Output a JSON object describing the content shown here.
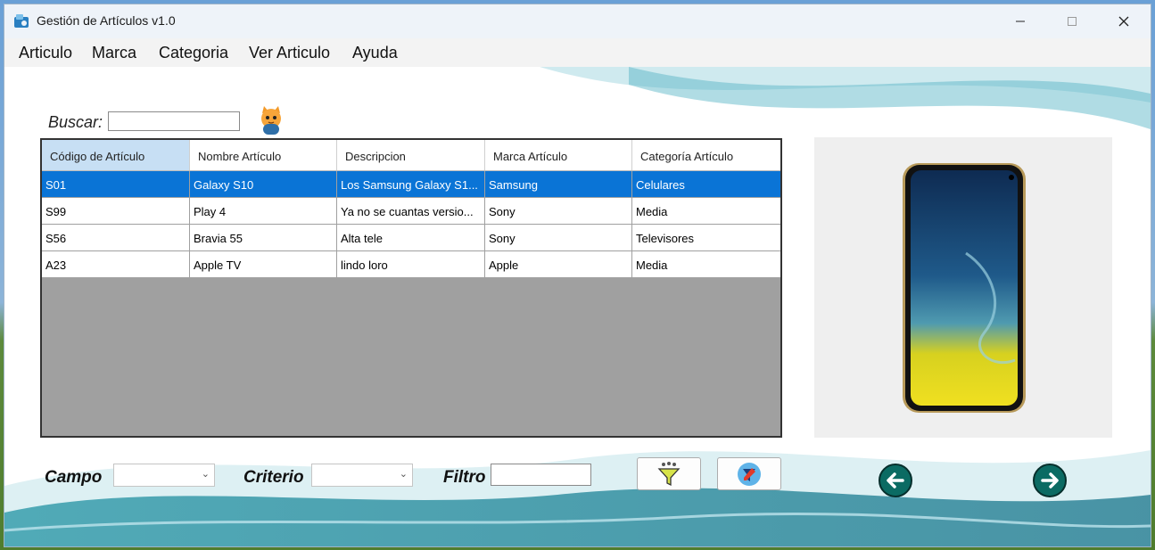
{
  "window": {
    "title": "Gestión de Artículos v1.0"
  },
  "menu": [
    "Articulo",
    "Marca",
    "Categoria",
    "Ver Articulo",
    "Ayuda"
  ],
  "search": {
    "label": "Buscar:",
    "value": ""
  },
  "grid": {
    "columns": [
      "Código de Artículo",
      "Nombre Artículo",
      "Descripcion",
      "Marca Artículo",
      "Categoría Artículo"
    ],
    "rows": [
      [
        "S01",
        "Galaxy S10",
        "Los Samsung Galaxy S1...",
        "Samsung",
        "Celulares"
      ],
      [
        "S99",
        "Play 4",
        "Ya no se cuantas versio...",
        "Sony",
        "Media"
      ],
      [
        "S56",
        "Bravia 55",
        "Alta tele",
        "Sony",
        "Televisores"
      ],
      [
        "A23",
        "Apple TV",
        "lindo loro",
        "Apple",
        "Media"
      ]
    ],
    "selected_row": 0
  },
  "filters": {
    "campo_label": "Campo",
    "campo_value": "",
    "criterio_label": "Criterio",
    "criterio_value": "",
    "filtro_label": "Filtro",
    "filtro_value": ""
  },
  "icons": {
    "app": "app-icon",
    "search": "search-mascot-icon",
    "filter": "funnel-filter-icon",
    "clear_filter": "clear-filter-icon",
    "prev": "arrow-left-icon",
    "next": "arrow-right-icon"
  },
  "colors": {
    "selection": "#0a74d6",
    "header_active": "#c7dff4",
    "grid_bg": "#a0a0a0",
    "nav_button": "#0b6b63"
  }
}
